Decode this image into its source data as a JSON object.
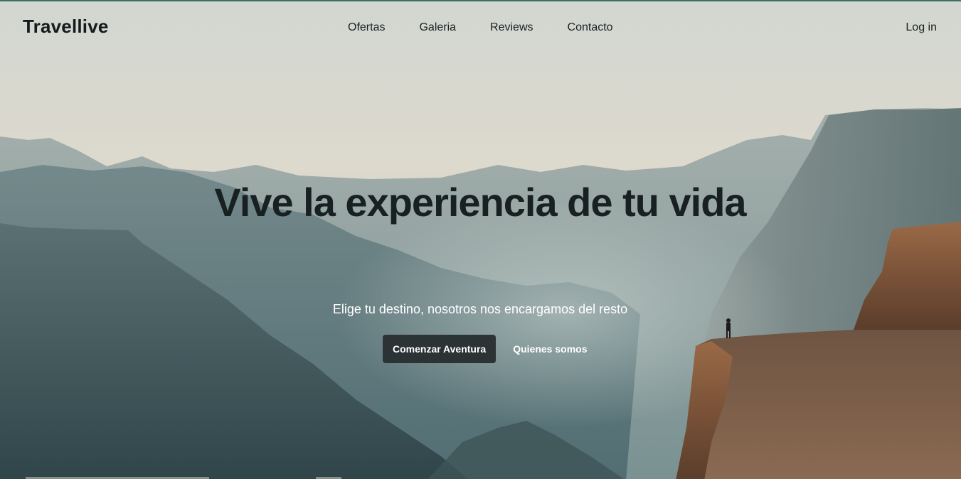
{
  "brand": "Travellive",
  "nav": {
    "links": [
      "Ofertas",
      "Galeria",
      "Reviews",
      "Contacto"
    ],
    "login": "Log in"
  },
  "hero": {
    "title": "Vive la experiencia de tu vida",
    "subtitle": "Elige tu destino, nosotros nos encargamos del resto",
    "primary_cta": "Comenzar Aventura",
    "secondary_cta": "Quienes somos",
    "image": "mountain-canyon-landscape-with-hiker-on-cliff"
  },
  "colors": {
    "sky_top": "#d3d7d1",
    "sky_bottom": "#ddd8cc",
    "mountain_far": "#8a9b9a",
    "mountain_mid": "#5f7a7d",
    "mountain_near": "#3f5a5f",
    "cliff": "#7a5238",
    "primary_button": "#2b3335",
    "text_dark": "#151a1c"
  }
}
